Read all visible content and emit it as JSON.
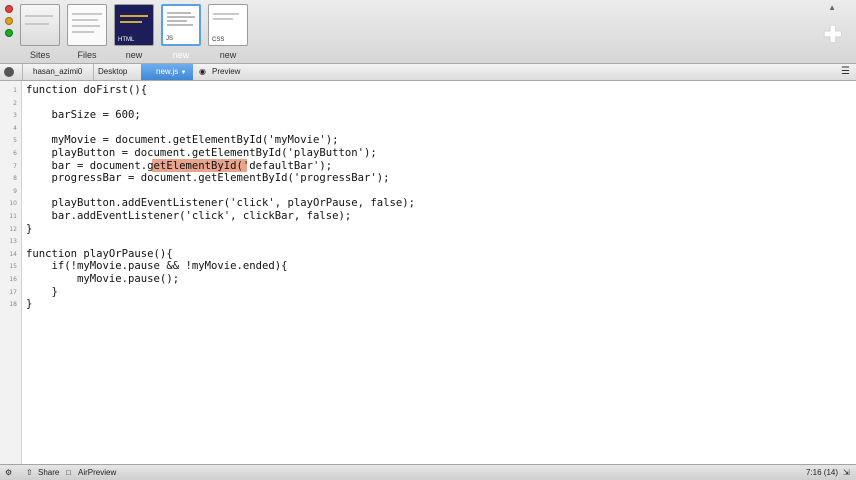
{
  "toolbar": {
    "tiles": [
      {
        "label": "Sites",
        "badge": ""
      },
      {
        "label": "Files",
        "badge": ""
      },
      {
        "label": "new",
        "badge": "HTML"
      },
      {
        "label": "new",
        "badge": "JS"
      },
      {
        "label": "new",
        "badge": "CSS"
      }
    ],
    "add_icon": "plus-icon"
  },
  "pathbar": {
    "user": "hasan_azimi0",
    "folder": "Desktop",
    "file": "new.js",
    "preview": "Preview"
  },
  "editor": {
    "line_numbers": [
      "1",
      "2",
      "3",
      "4",
      "5",
      "6",
      "7",
      "8",
      "9",
      "10",
      "11",
      "12",
      "13",
      "14",
      "15",
      "16",
      "17",
      "18"
    ],
    "lines": [
      "function doFirst(){",
      "",
      "    barSize = 600;",
      "",
      "    myMovie = document.getElementById('myMovie');",
      "    playButton = document.getElementById('playButton');",
      "    bar = document.getElementById('defaultBar');",
      "    progressBar = document.getElementById('progressBar');",
      "",
      "    playButton.addEventListener('click', playOrPause, false);",
      "    bar.addEventListener('click', clickBar, false);",
      "}",
      "",
      "function playOrPause(){",
      "    if(!myMovie.pause && !myMovie.ended){",
      "        myMovie.pause();",
      "    }",
      "}"
    ]
  },
  "statusbar": {
    "share": "Share",
    "airpreview": "AirPreview",
    "position": "7:16 (14)"
  }
}
